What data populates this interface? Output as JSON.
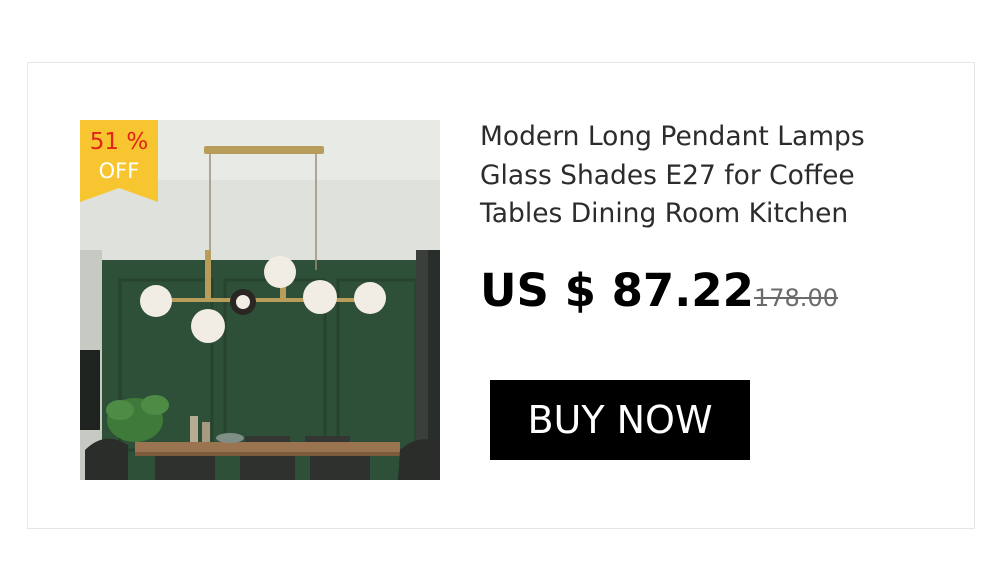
{
  "badge": {
    "percent": "51 %",
    "off": "OFF",
    "color": "#f7c52f"
  },
  "product": {
    "title_lines": [
      "Modern Long Pendant Lamps",
      "Glass Shades E27 for Coffee",
      "Tables Dining Room Kitchen"
    ],
    "price": "US $ 87.22",
    "old_price": "178.00"
  },
  "cta": {
    "label": "BUY NOW"
  },
  "colors": {
    "wall": "#2f5038",
    "brass": "#b89c5a",
    "cta_bg": "#000000",
    "badge_text": "#e12417"
  },
  "image": {
    "icon": "pendant-lamp-photo"
  }
}
